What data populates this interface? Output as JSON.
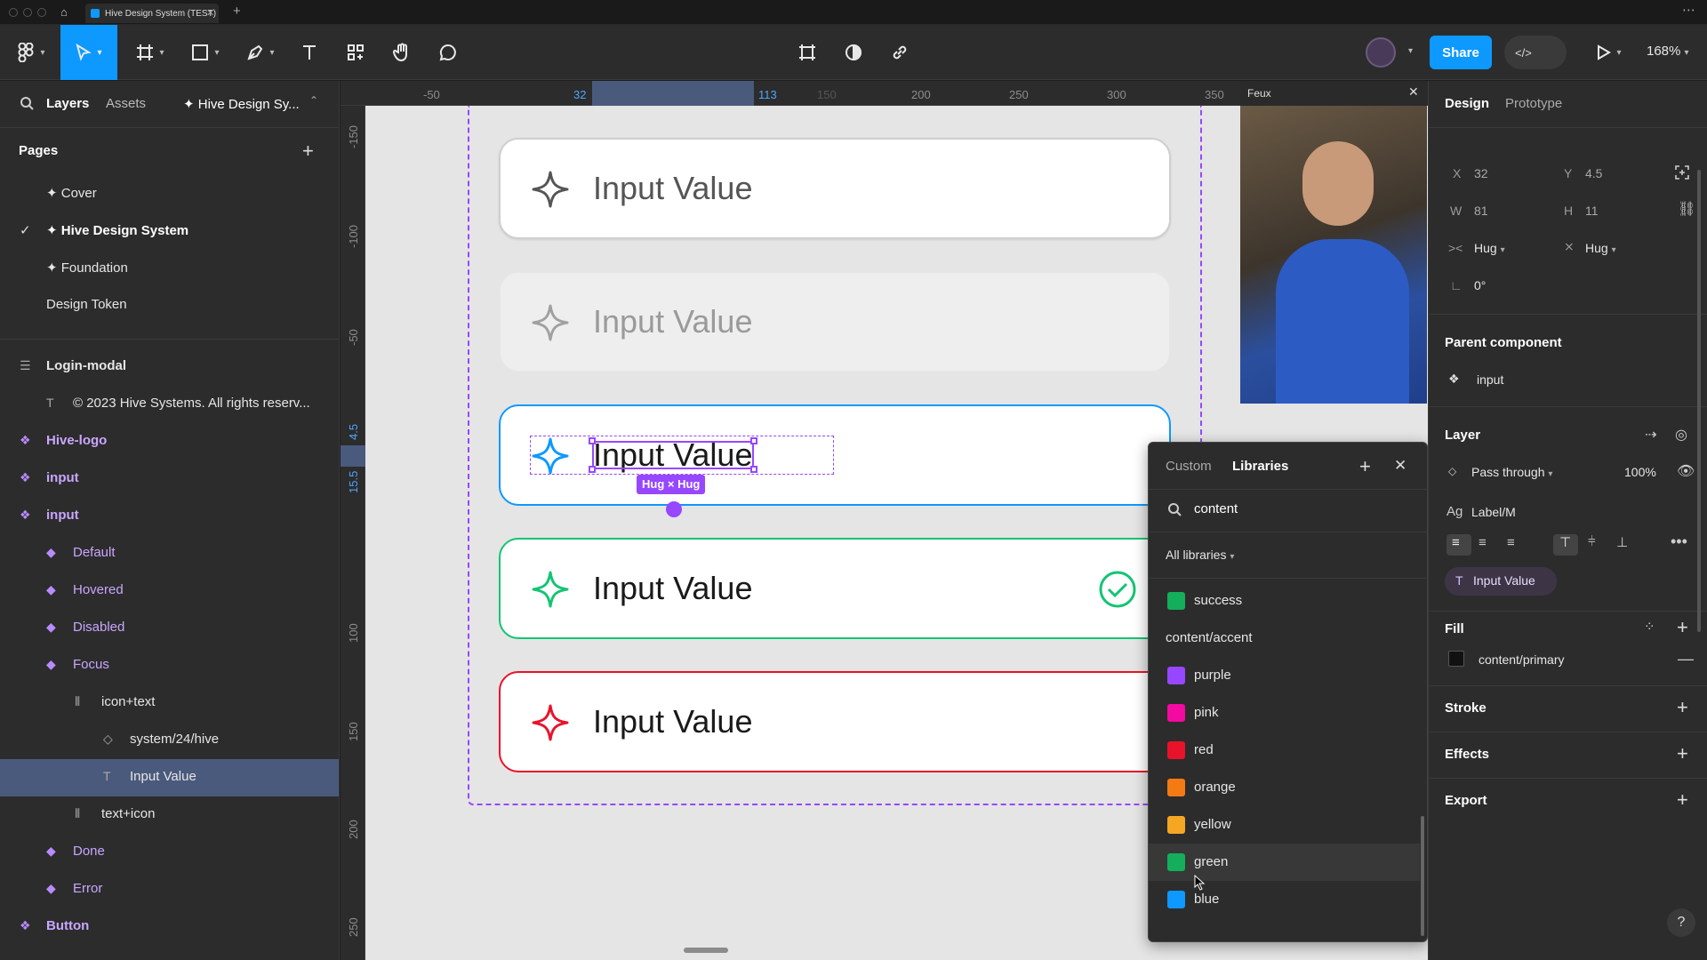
{
  "titlebar": {
    "tab_title": "Hive Design System (TEST)"
  },
  "toolbar": {
    "share_label": "Share",
    "zoom": "168%",
    "colors": {
      "primary": "#0d99ff",
      "bg": "#2c2c2c"
    }
  },
  "left_panel": {
    "tabs": [
      "Layers",
      "Assets"
    ],
    "file_name": "✦ Hive Design Sy...",
    "pages_title": "Pages",
    "pages": [
      {
        "label": "✦ Cover",
        "active": false
      },
      {
        "label": "✦ Hive Design System",
        "active": true
      },
      {
        "label": "✦ Foundation",
        "active": false
      },
      {
        "label": "Design Token",
        "active": false
      }
    ],
    "layers": [
      {
        "label": "Login-modal",
        "icon": "frame-icon",
        "indent": 0
      },
      {
        "label": "© 2023 Hive Systems. All rights reserv...",
        "icon": "text-icon",
        "indent": 1
      },
      {
        "label": "Hive-logo",
        "icon": "component-icon",
        "indent": 0
      },
      {
        "label": "input",
        "icon": "component-icon",
        "indent": 0
      },
      {
        "label": "input",
        "icon": "component-icon",
        "indent": 0
      },
      {
        "label": "Default",
        "icon": "variant-icon",
        "indent": 1
      },
      {
        "label": "Hovered",
        "icon": "variant-icon",
        "indent": 1
      },
      {
        "label": "Disabled",
        "icon": "variant-icon",
        "indent": 1
      },
      {
        "label": "Focus",
        "icon": "variant-icon",
        "indent": 1
      },
      {
        "label": "icon+text",
        "icon": "autolayout-icon",
        "indent": 2
      },
      {
        "label": "system/24/hive",
        "icon": "instance-icon",
        "indent": 3
      },
      {
        "label": "Input Value",
        "icon": "text-icon",
        "indent": 3,
        "selected": true
      },
      {
        "label": "text+icon",
        "icon": "autolayout-icon",
        "indent": 2
      },
      {
        "label": "Done",
        "icon": "variant-icon",
        "indent": 1
      },
      {
        "label": "Error",
        "icon": "variant-icon",
        "indent": 1
      },
      {
        "label": "Button",
        "icon": "component-icon",
        "indent": 0
      }
    ]
  },
  "rulers": {
    "h_ticks": [
      "-50",
      "32",
      "113",
      "150",
      "200",
      "250",
      "300",
      "350"
    ],
    "v_ticks": [
      "-150",
      "-100",
      "-50",
      "4.5",
      "15.5",
      "100",
      "150",
      "200",
      "250"
    ]
  },
  "canvas": {
    "cards": [
      {
        "label": "Input Value",
        "state": "default"
      },
      {
        "label": "Input Value",
        "state": "disabled"
      },
      {
        "label": "Input Value",
        "state": "focus"
      },
      {
        "label": "Input Value",
        "state": "done"
      },
      {
        "label": "Input Value",
        "state": "error"
      }
    ],
    "size_badge": "Hug × Hug"
  },
  "video": {
    "title": "Feux"
  },
  "libraries_panel": {
    "tabs": [
      "Custom",
      "Libraries"
    ],
    "search_value": "content",
    "filter": "All libraries",
    "items": [
      {
        "label": "success",
        "color": "#14ae5c",
        "type": "swatch"
      },
      {
        "label": "content/accent",
        "type": "group"
      },
      {
        "label": "purple",
        "color": "#9747ff",
        "type": "swatch"
      },
      {
        "label": "pink",
        "color": "#f20aa1",
        "type": "swatch"
      },
      {
        "label": "red",
        "color": "#e8132b",
        "type": "swatch"
      },
      {
        "label": "orange",
        "color": "#f47a14",
        "type": "swatch"
      },
      {
        "label": "yellow",
        "color": "#f5a623",
        "type": "swatch"
      },
      {
        "label": "green",
        "color": "#14ae5c",
        "type": "swatch"
      },
      {
        "label": "blue",
        "color": "#0d99ff",
        "type": "swatch"
      }
    ]
  },
  "right_panel": {
    "tabs": [
      "Design",
      "Prototype"
    ],
    "x_label": "X",
    "x_value": "32",
    "y_label": "Y",
    "y_value": "4.5",
    "w_label": "W",
    "w_value": "81",
    "h_label": "H",
    "h_value": "11",
    "hug_h": "Hug",
    "hug_v": "Hug",
    "rotation": "0°",
    "parent_component_title": "Parent component",
    "parent_component": "input",
    "layer_title": "Layer",
    "blend_mode": "Pass through",
    "opacity": "100%",
    "text_style": "Label/M",
    "text_chip": "Input Value",
    "fill_title": "Fill",
    "fill_value": "content/primary",
    "stroke_title": "Stroke",
    "effects_title": "Effects",
    "export_title": "Export"
  }
}
